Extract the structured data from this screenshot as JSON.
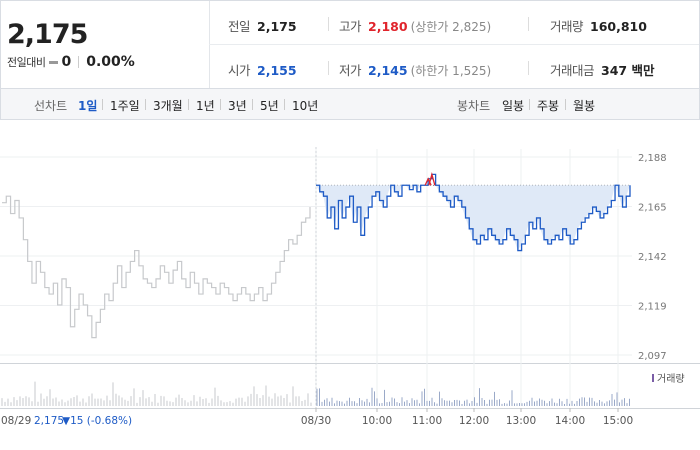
{
  "quote": {
    "price": "2,175",
    "change_label": "전일대비",
    "change_value": "0",
    "change_pct": "0.00%",
    "fields": [
      {
        "key": "전일",
        "value": "2,175",
        "sub": ""
      },
      {
        "key": "고가",
        "value": "2,180",
        "sub": "(상한가 2,825)",
        "tone": "up"
      },
      {
        "key": "거래량",
        "value": "160,810",
        "sub": ""
      },
      {
        "key": "시가",
        "value": "2,155",
        "sub": "",
        "tone": "down"
      },
      {
        "key": "저가",
        "value": "2,145",
        "sub": "(하한가 1,525)",
        "tone": "down"
      },
      {
        "key": "거래대금",
        "value": "347 백만",
        "sub": ""
      }
    ],
    "colors": {
      "up": "#e0242c",
      "down": "#1e5bc6"
    }
  },
  "tabs": {
    "line_label": "선차트",
    "line_periods": [
      "1일",
      "1주일",
      "3개월",
      "1년",
      "3년",
      "5년",
      "10년"
    ],
    "line_selected": "1일",
    "candle_label": "봉차트",
    "candle_periods": [
      "일봉",
      "주봉",
      "월봉"
    ]
  },
  "chart_data": {
    "type": "line",
    "y_ticks": [
      "2,188",
      "2,165",
      "2,142",
      "2,119",
      "2,097"
    ],
    "ylim": [
      2097,
      2188
    ],
    "x_ticks": [
      "08/30",
      "10:00",
      "11:00",
      "12:00",
      "13:00",
      "14:00",
      "15:00"
    ],
    "reference_value": 2175,
    "previous_day": {
      "label": "08/29",
      "close": "2,175",
      "change": "▼15 (-0.68%)",
      "values": [
        2167,
        2170,
        2162,
        2168,
        2160,
        2150,
        2140,
        2130,
        2140,
        2135,
        2128,
        2125,
        2130,
        2120,
        2132,
        2128,
        2110,
        2118,
        2125,
        2120,
        2115,
        2105,
        2112,
        2118,
        2125,
        2122,
        2130,
        2138,
        2128,
        2135,
        2140,
        2145,
        2138,
        2132,
        2130,
        2128,
        2132,
        2138,
        2135,
        2130,
        2136,
        2140,
        2132,
        2128,
        2135,
        2130,
        2125,
        2132,
        2130,
        2128,
        2125,
        2130,
        2128,
        2125,
        2122,
        2125,
        2128,
        2125,
        2122,
        2125,
        2128,
        2122,
        2125,
        2130,
        2135,
        2140,
        2145,
        2150,
        2148,
        2152,
        2158,
        2160,
        2165
      ]
    },
    "today": {
      "values": [
        2175,
        2172,
        2170,
        2160,
        2165,
        2155,
        2168,
        2160,
        2165,
        2170,
        2158,
        2165,
        2152,
        2160,
        2165,
        2170,
        2172,
        2168,
        2165,
        2170,
        2175,
        2172,
        2170,
        2175,
        2175,
        2173,
        2175,
        2172,
        2175,
        2175,
        2178,
        2180,
        2175,
        2172,
        2170,
        2168,
        2165,
        2170,
        2168,
        2165,
        2160,
        2155,
        2150,
        2148,
        2152,
        2150,
        2155,
        2152,
        2150,
        2148,
        2150,
        2155,
        2152,
        2150,
        2145,
        2148,
        2152,
        2158,
        2155,
        2160,
        2155,
        2150,
        2148,
        2150,
        2152,
        2150,
        2155,
        2152,
        2148,
        2150,
        2155,
        2158,
        2160,
        2162,
        2165,
        2163,
        2160,
        2162,
        2165,
        2168,
        2175,
        2170,
        2165,
        2170,
        2175
      ]
    },
    "volume_label": "거래량",
    "series_colors": {
      "previous": "#c7c9cc",
      "today": "#1e5bc6",
      "above": "#e0242c",
      "fill": "#dfe9f7"
    }
  }
}
